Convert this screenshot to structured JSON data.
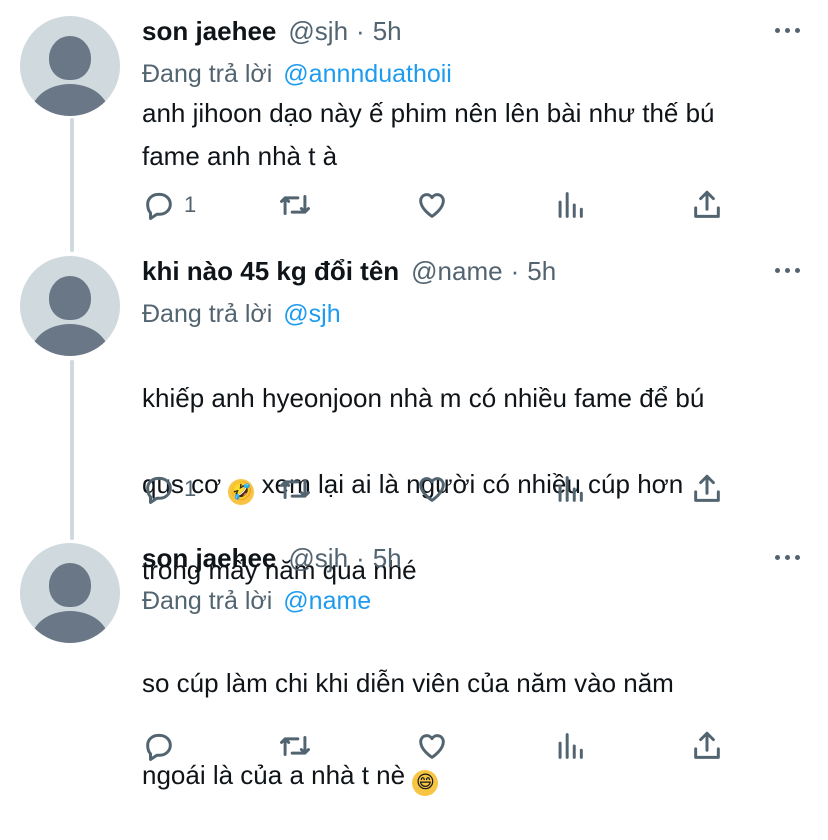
{
  "tweets": [
    {
      "name": "son jaehee",
      "handle": "@sjh",
      "dot": "·",
      "time": "5h",
      "replying_label": "Đang trả lời",
      "replying_to": "@annnduathoii",
      "text": "anh jihoon dạo này ế phim nên lên bài như thế bú\nfame anh nhà t à",
      "reply_count": "1",
      "more_icon": "more-horizontal-icon"
    },
    {
      "name": "khi nào 45 kg đổi tên",
      "handle": "@name",
      "dot": "·",
      "time": "5h",
      "replying_label": "Đang trả lời",
      "replying_to": "@sjh",
      "text_line1": "khiếp anh hyeonjoon nhà m có nhiều fame để bú",
      "text_line2a": "qus cơ",
      "emoji": "🤣",
      "text_line2b": " xem lại ai là người có nhiều cúp hơn",
      "text_line3": "trong mấy năm qua nhé",
      "reply_count": "1",
      "more_icon": "more-horizontal-icon"
    },
    {
      "name": "son jaehee",
      "handle": "@sjh",
      "dot": "·",
      "time": "5h",
      "replying_label": "Đang trả lời",
      "replying_to": "@name",
      "text_line1": "so cúp làm chi khi diễn viên của năm vào năm",
      "text_line2": "ngoái là của a nhà t nè",
      "emoji": "😄",
      "reply_count": "",
      "more_icon": "more-horizontal-icon"
    }
  ],
  "colors": {
    "text": "#0f1419",
    "secondary": "#536471",
    "link": "#1d9bf0",
    "avatar_bg": "#cfd9de",
    "avatar_fg": "#697786",
    "thread_line": "#cfd9de"
  },
  "action_icons": [
    "reply-icon",
    "retweet-icon",
    "like-icon",
    "analytics-icon",
    "share-icon"
  ]
}
